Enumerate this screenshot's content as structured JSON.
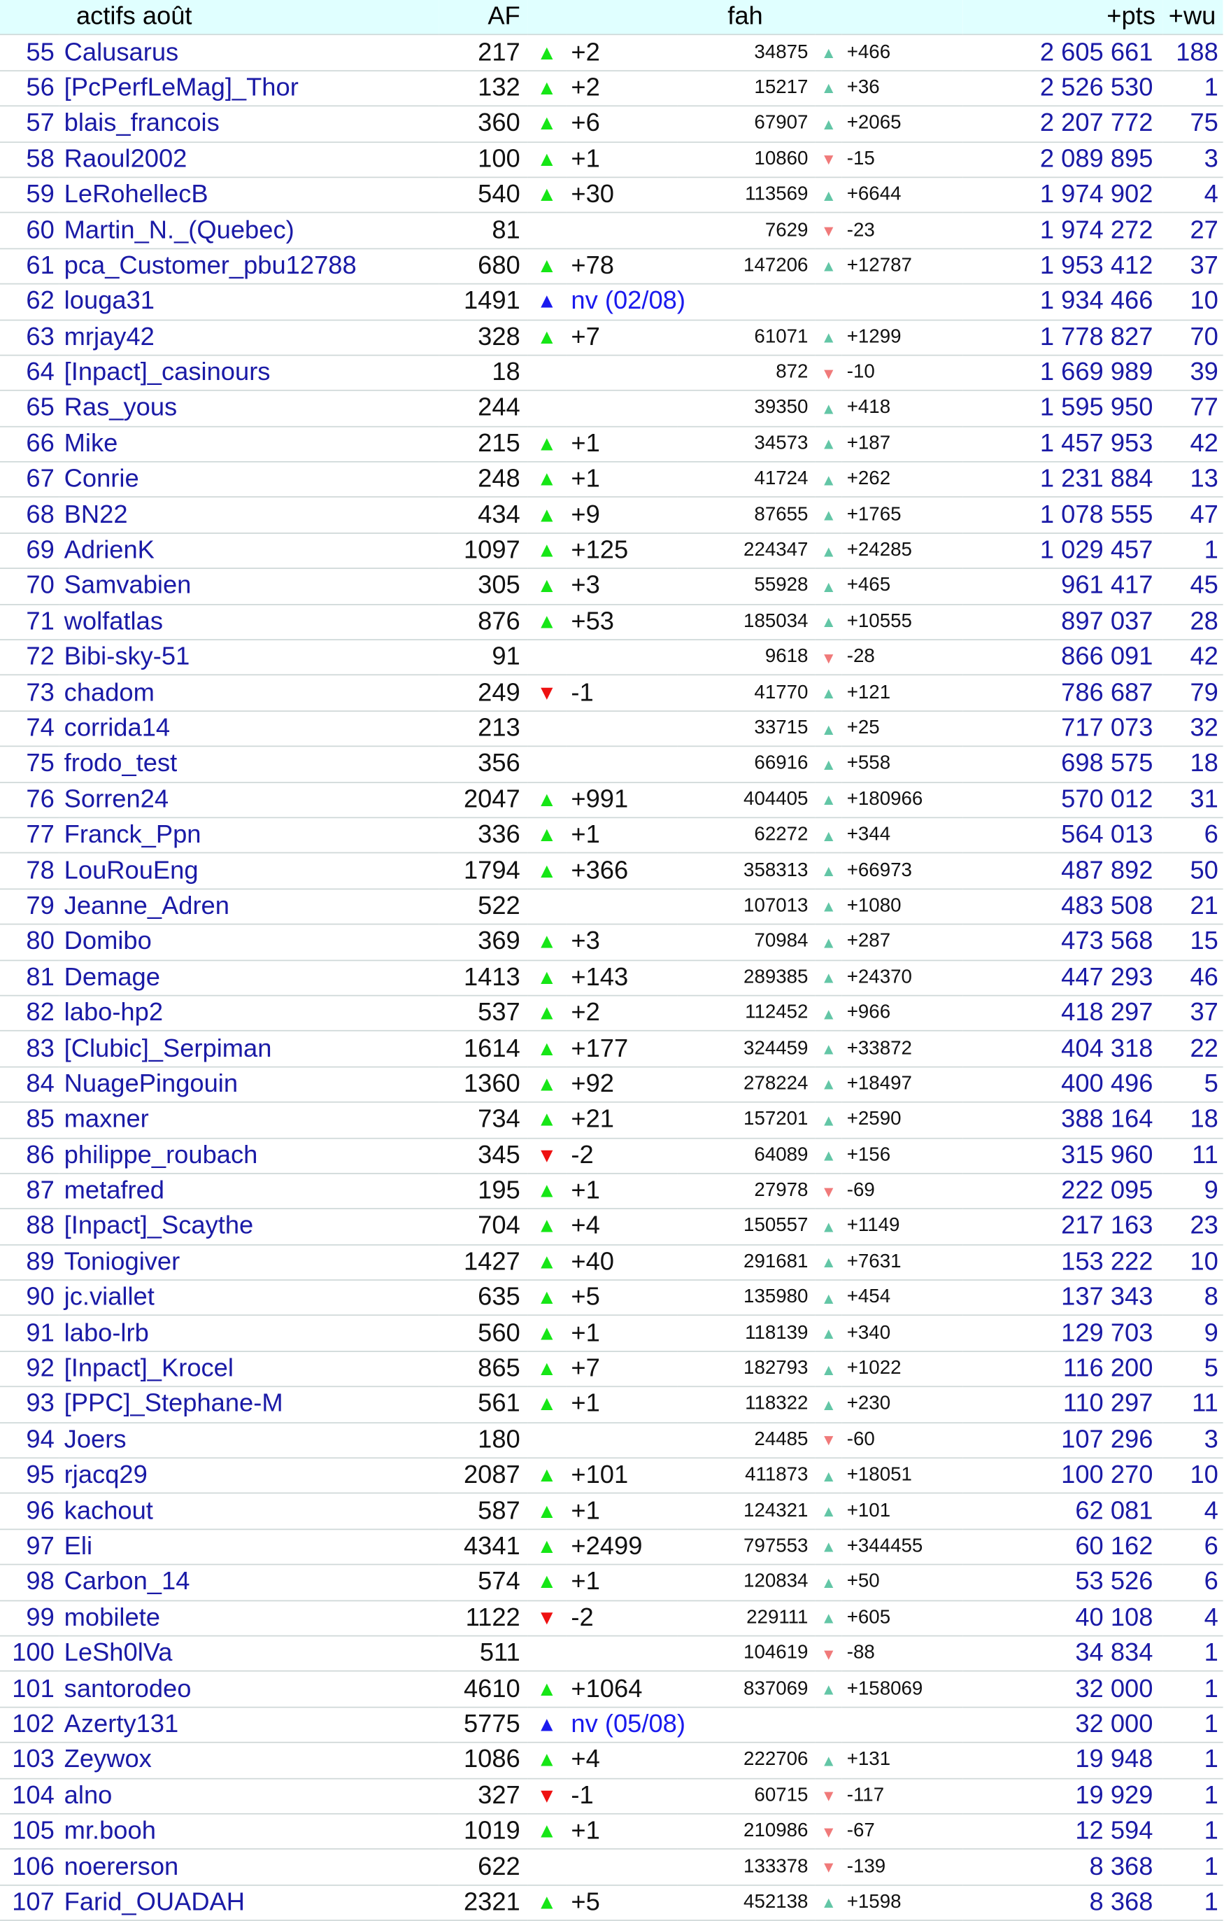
{
  "headers": {
    "name": "actifs août",
    "af": "AF",
    "fah": "fah",
    "pts": "+pts",
    "wu": "+wu"
  },
  "colors": {
    "header_bg": "#e0ffff",
    "af_up": "#16e616",
    "af_down": "#ee1111",
    "af_new": "#1a1aee",
    "fah_up": "#63c6a6",
    "fah_down": "#f07a7a",
    "link_text": "#1a1aa6"
  },
  "rows": [
    {
      "rank": "55",
      "name": "Calusarus",
      "af": "217",
      "af_trend": "up",
      "af_delta": "+2",
      "fah": "34875",
      "fah_trend": "up",
      "fah_delta": "+466",
      "pts": "2 605 661",
      "wu": "188"
    },
    {
      "rank": "56",
      "name": "[PcPerfLeMag]_Thor",
      "af": "132",
      "af_trend": "up",
      "af_delta": "+2",
      "fah": "15217",
      "fah_trend": "up",
      "fah_delta": "+36",
      "pts": "2 526 530",
      "wu": "1"
    },
    {
      "rank": "57",
      "name": "blais_francois",
      "af": "360",
      "af_trend": "up",
      "af_delta": "+6",
      "fah": "67907",
      "fah_trend": "up",
      "fah_delta": "+2065",
      "pts": "2 207 772",
      "wu": "75"
    },
    {
      "rank": "58",
      "name": "Raoul2002",
      "af": "100",
      "af_trend": "up",
      "af_delta": "+1",
      "fah": "10860",
      "fah_trend": "down",
      "fah_delta": "-15",
      "pts": "2 089 895",
      "wu": "3"
    },
    {
      "rank": "59",
      "name": "LeRohellecB",
      "af": "540",
      "af_trend": "up",
      "af_delta": "+30",
      "fah": "113569",
      "fah_trend": "up",
      "fah_delta": "+6644",
      "pts": "1 974 902",
      "wu": "4"
    },
    {
      "rank": "60",
      "name": "Martin_N._(Quebec)",
      "af": "81",
      "af_trend": "",
      "af_delta": "",
      "fah": "7629",
      "fah_trend": "down",
      "fah_delta": "-23",
      "pts": "1 974 272",
      "wu": "27"
    },
    {
      "rank": "61",
      "name": "pca_Customer_pbu12788",
      "af": "680",
      "af_trend": "up",
      "af_delta": "+78",
      "fah": "147206",
      "fah_trend": "up",
      "fah_delta": "+12787",
      "pts": "1 953 412",
      "wu": "37"
    },
    {
      "rank": "62",
      "name": "louga31",
      "af": "1491",
      "af_trend": "new",
      "af_delta": "nv (02/08)",
      "fah": "",
      "fah_trend": "",
      "fah_delta": "",
      "pts": "1 934 466",
      "wu": "10"
    },
    {
      "rank": "63",
      "name": "mrjay42",
      "af": "328",
      "af_trend": "up",
      "af_delta": "+7",
      "fah": "61071",
      "fah_trend": "up",
      "fah_delta": "+1299",
      "pts": "1 778 827",
      "wu": "70"
    },
    {
      "rank": "64",
      "name": "[Inpact]_casinours",
      "af": "18",
      "af_trend": "",
      "af_delta": "",
      "fah": "872",
      "fah_trend": "down",
      "fah_delta": "-10",
      "pts": "1 669 989",
      "wu": "39"
    },
    {
      "rank": "65",
      "name": "Ras_yous",
      "af": "244",
      "af_trend": "",
      "af_delta": "",
      "fah": "39350",
      "fah_trend": "up",
      "fah_delta": "+418",
      "pts": "1 595 950",
      "wu": "77"
    },
    {
      "rank": "66",
      "name": "Mike",
      "af": "215",
      "af_trend": "up",
      "af_delta": "+1",
      "fah": "34573",
      "fah_trend": "up",
      "fah_delta": "+187",
      "pts": "1 457 953",
      "wu": "42"
    },
    {
      "rank": "67",
      "name": "Conrie",
      "af": "248",
      "af_trend": "up",
      "af_delta": "+1",
      "fah": "41724",
      "fah_trend": "up",
      "fah_delta": "+262",
      "pts": "1 231 884",
      "wu": "13"
    },
    {
      "rank": "68",
      "name": "BN22",
      "af": "434",
      "af_trend": "up",
      "af_delta": "+9",
      "fah": "87655",
      "fah_trend": "up",
      "fah_delta": "+1765",
      "pts": "1 078 555",
      "wu": "47"
    },
    {
      "rank": "69",
      "name": "AdrienK",
      "af": "1097",
      "af_trend": "up",
      "af_delta": "+125",
      "fah": "224347",
      "fah_trend": "up",
      "fah_delta": "+24285",
      "pts": "1 029 457",
      "wu": "1"
    },
    {
      "rank": "70",
      "name": "Samvabien",
      "af": "305",
      "af_trend": "up",
      "af_delta": "+3",
      "fah": "55928",
      "fah_trend": "up",
      "fah_delta": "+465",
      "pts": "961 417",
      "wu": "45"
    },
    {
      "rank": "71",
      "name": "wolfatlas",
      "af": "876",
      "af_trend": "up",
      "af_delta": "+53",
      "fah": "185034",
      "fah_trend": "up",
      "fah_delta": "+10555",
      "pts": "897 037",
      "wu": "28"
    },
    {
      "rank": "72",
      "name": "Bibi-sky-51",
      "af": "91",
      "af_trend": "",
      "af_delta": "",
      "fah": "9618",
      "fah_trend": "down",
      "fah_delta": "-28",
      "pts": "866 091",
      "wu": "42"
    },
    {
      "rank": "73",
      "name": "chadom",
      "af": "249",
      "af_trend": "down",
      "af_delta": "-1",
      "fah": "41770",
      "fah_trend": "up",
      "fah_delta": "+121",
      "pts": "786 687",
      "wu": "79"
    },
    {
      "rank": "74",
      "name": "corrida14",
      "af": "213",
      "af_trend": "",
      "af_delta": "",
      "fah": "33715",
      "fah_trend": "up",
      "fah_delta": "+25",
      "pts": "717 073",
      "wu": "32"
    },
    {
      "rank": "75",
      "name": "frodo_test",
      "af": "356",
      "af_trend": "",
      "af_delta": "",
      "fah": "66916",
      "fah_trend": "up",
      "fah_delta": "+558",
      "pts": "698 575",
      "wu": "18"
    },
    {
      "rank": "76",
      "name": "Sorren24",
      "af": "2047",
      "af_trend": "up",
      "af_delta": "+991",
      "fah": "404405",
      "fah_trend": "up",
      "fah_delta": "+180966",
      "pts": "570 012",
      "wu": "31"
    },
    {
      "rank": "77",
      "name": "Franck_Ppn",
      "af": "336",
      "af_trend": "up",
      "af_delta": "+1",
      "fah": "62272",
      "fah_trend": "up",
      "fah_delta": "+344",
      "pts": "564 013",
      "wu": "6"
    },
    {
      "rank": "78",
      "name": "LouRouEng",
      "af": "1794",
      "af_trend": "up",
      "af_delta": "+366",
      "fah": "358313",
      "fah_trend": "up",
      "fah_delta": "+66973",
      "pts": "487 892",
      "wu": "50"
    },
    {
      "rank": "79",
      "name": "Jeanne_Adren",
      "af": "522",
      "af_trend": "",
      "af_delta": "",
      "fah": "107013",
      "fah_trend": "up",
      "fah_delta": "+1080",
      "pts": "483 508",
      "wu": "21"
    },
    {
      "rank": "80",
      "name": "Domibo",
      "af": "369",
      "af_trend": "up",
      "af_delta": "+3",
      "fah": "70984",
      "fah_trend": "up",
      "fah_delta": "+287",
      "pts": "473 568",
      "wu": "15"
    },
    {
      "rank": "81",
      "name": "Demage",
      "af": "1413",
      "af_trend": "up",
      "af_delta": "+143",
      "fah": "289385",
      "fah_trend": "up",
      "fah_delta": "+24370",
      "pts": "447 293",
      "wu": "46"
    },
    {
      "rank": "82",
      "name": "labo-hp2",
      "af": "537",
      "af_trend": "up",
      "af_delta": "+2",
      "fah": "112452",
      "fah_trend": "up",
      "fah_delta": "+966",
      "pts": "418 297",
      "wu": "37"
    },
    {
      "rank": "83",
      "name": "[Clubic]_Serpiman",
      "af": "1614",
      "af_trend": "up",
      "af_delta": "+177",
      "fah": "324459",
      "fah_trend": "up",
      "fah_delta": "+33872",
      "pts": "404 318",
      "wu": "22"
    },
    {
      "rank": "84",
      "name": "NuagePingouin",
      "af": "1360",
      "af_trend": "up",
      "af_delta": "+92",
      "fah": "278224",
      "fah_trend": "up",
      "fah_delta": "+18497",
      "pts": "400 496",
      "wu": "5"
    },
    {
      "rank": "85",
      "name": "maxner",
      "af": "734",
      "af_trend": "up",
      "af_delta": "+21",
      "fah": "157201",
      "fah_trend": "up",
      "fah_delta": "+2590",
      "pts": "388 164",
      "wu": "18"
    },
    {
      "rank": "86",
      "name": "philippe_roubach",
      "af": "345",
      "af_trend": "down",
      "af_delta": "-2",
      "fah": "64089",
      "fah_trend": "up",
      "fah_delta": "+156",
      "pts": "315 960",
      "wu": "11"
    },
    {
      "rank": "87",
      "name": "metafred",
      "af": "195",
      "af_trend": "up",
      "af_delta": "+1",
      "fah": "27978",
      "fah_trend": "down",
      "fah_delta": "-69",
      "pts": "222 095",
      "wu": "9"
    },
    {
      "rank": "88",
      "name": "[Inpact]_Scaythe",
      "af": "704",
      "af_trend": "up",
      "af_delta": "+4",
      "fah": "150557",
      "fah_trend": "up",
      "fah_delta": "+1149",
      "pts": "217 163",
      "wu": "23"
    },
    {
      "rank": "89",
      "name": "Toniogiver",
      "af": "1427",
      "af_trend": "up",
      "af_delta": "+40",
      "fah": "291681",
      "fah_trend": "up",
      "fah_delta": "+7631",
      "pts": "153 222",
      "wu": "10"
    },
    {
      "rank": "90",
      "name": "jc.viallet",
      "af": "635",
      "af_trend": "up",
      "af_delta": "+5",
      "fah": "135980",
      "fah_trend": "up",
      "fah_delta": "+454",
      "pts": "137 343",
      "wu": "8"
    },
    {
      "rank": "91",
      "name": "labo-lrb",
      "af": "560",
      "af_trend": "up",
      "af_delta": "+1",
      "fah": "118139",
      "fah_trend": "up",
      "fah_delta": "+340",
      "pts": "129 703",
      "wu": "9"
    },
    {
      "rank": "92",
      "name": "[Inpact]_Krocel",
      "af": "865",
      "af_trend": "up",
      "af_delta": "+7",
      "fah": "182793",
      "fah_trend": "up",
      "fah_delta": "+1022",
      "pts": "116 200",
      "wu": "5"
    },
    {
      "rank": "93",
      "name": "[PPC]_Stephane-M",
      "af": "561",
      "af_trend": "up",
      "af_delta": "+1",
      "fah": "118322",
      "fah_trend": "up",
      "fah_delta": "+230",
      "pts": "110 297",
      "wu": "11"
    },
    {
      "rank": "94",
      "name": "Joers",
      "af": "180",
      "af_trend": "",
      "af_delta": "",
      "fah": "24485",
      "fah_trend": "down",
      "fah_delta": "-60",
      "pts": "107 296",
      "wu": "3"
    },
    {
      "rank": "95",
      "name": "rjacq29",
      "af": "2087",
      "af_trend": "up",
      "af_delta": "+101",
      "fah": "411873",
      "fah_trend": "up",
      "fah_delta": "+18051",
      "pts": "100 270",
      "wu": "10"
    },
    {
      "rank": "96",
      "name": "kachout",
      "af": "587",
      "af_trend": "up",
      "af_delta": "+1",
      "fah": "124321",
      "fah_trend": "up",
      "fah_delta": "+101",
      "pts": "62 081",
      "wu": "4"
    },
    {
      "rank": "97",
      "name": "Eli",
      "af": "4341",
      "af_trend": "up",
      "af_delta": "+2499",
      "fah": "797553",
      "fah_trend": "up",
      "fah_delta": "+344455",
      "pts": "60 162",
      "wu": "6"
    },
    {
      "rank": "98",
      "name": "Carbon_14",
      "af": "574",
      "af_trend": "up",
      "af_delta": "+1",
      "fah": "120834",
      "fah_trend": "up",
      "fah_delta": "+50",
      "pts": "53 526",
      "wu": "6"
    },
    {
      "rank": "99",
      "name": "mobilete",
      "af": "1122",
      "af_trend": "down",
      "af_delta": "-2",
      "fah": "229111",
      "fah_trend": "up",
      "fah_delta": "+605",
      "pts": "40 108",
      "wu": "4"
    },
    {
      "rank": "100",
      "name": "LeSh0lVa",
      "af": "511",
      "af_trend": "",
      "af_delta": "",
      "fah": "104619",
      "fah_trend": "down",
      "fah_delta": "-88",
      "pts": "34 834",
      "wu": "1"
    },
    {
      "rank": "101",
      "name": "santorodeo",
      "af": "4610",
      "af_trend": "up",
      "af_delta": "+1064",
      "fah": "837069",
      "fah_trend": "up",
      "fah_delta": "+158069",
      "pts": "32 000",
      "wu": "1"
    },
    {
      "rank": "102",
      "name": "Azerty131",
      "af": "5775",
      "af_trend": "new",
      "af_delta": "nv (05/08)",
      "fah": "",
      "fah_trend": "",
      "fah_delta": "",
      "pts": "32 000",
      "wu": "1"
    },
    {
      "rank": "103",
      "name": "Zeywox",
      "af": "1086",
      "af_trend": "up",
      "af_delta": "+4",
      "fah": "222706",
      "fah_trend": "up",
      "fah_delta": "+131",
      "pts": "19 948",
      "wu": "1"
    },
    {
      "rank": "104",
      "name": "alno",
      "af": "327",
      "af_trend": "down",
      "af_delta": "-1",
      "fah": "60715",
      "fah_trend": "down",
      "fah_delta": "-117",
      "pts": "19 929",
      "wu": "1"
    },
    {
      "rank": "105",
      "name": "mr.booh",
      "af": "1019",
      "af_trend": "up",
      "af_delta": "+1",
      "fah": "210986",
      "fah_trend": "down",
      "fah_delta": "-67",
      "pts": "12 594",
      "wu": "1"
    },
    {
      "rank": "106",
      "name": "noererson",
      "af": "622",
      "af_trend": "",
      "af_delta": "",
      "fah": "133378",
      "fah_trend": "down",
      "fah_delta": "-139",
      "pts": "8 368",
      "wu": "1"
    },
    {
      "rank": "107",
      "name": "Farid_OUADAH",
      "af": "2321",
      "af_trend": "up",
      "af_delta": "+5",
      "fah": "452138",
      "fah_trend": "up",
      "fah_delta": "+1598",
      "pts": "8 368",
      "wu": "1"
    }
  ]
}
